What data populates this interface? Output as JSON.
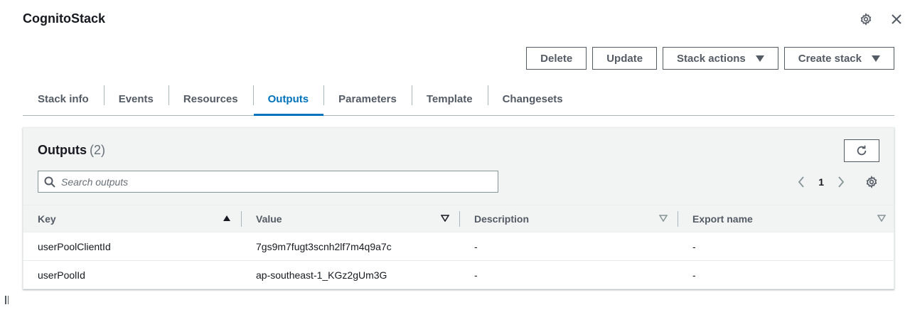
{
  "header": {
    "title": "CognitoStack",
    "settings_icon": "gear-icon",
    "close_icon": "close-icon"
  },
  "actions": {
    "delete": "Delete",
    "update": "Update",
    "stack_actions": "Stack actions",
    "create_stack": "Create stack"
  },
  "tabs": [
    {
      "label": "Stack info",
      "active": false
    },
    {
      "label": "Events",
      "active": false
    },
    {
      "label": "Resources",
      "active": false
    },
    {
      "label": "Outputs",
      "active": true
    },
    {
      "label": "Parameters",
      "active": false
    },
    {
      "label": "Template",
      "active": false
    },
    {
      "label": "Changesets",
      "active": false
    }
  ],
  "outputs": {
    "title": "Outputs",
    "count": "(2)",
    "search_placeholder": "Search outputs",
    "page": "1",
    "columns": [
      "Key",
      "Value",
      "Description",
      "Export name"
    ],
    "rows": [
      {
        "key": "userPoolClientId",
        "value": "7gs9m7fugt3scnh2lf7m4q9a7c",
        "description": "-",
        "export_name": "-"
      },
      {
        "key": "userPoolId",
        "value": "ap-southeast-1_KGz2gUm3G",
        "description": "-",
        "export_name": "-"
      }
    ]
  },
  "colors": {
    "accent": "#0073bb",
    "text": "#16191f",
    "muted": "#545b64",
    "header_bg": "#f2f3f3"
  }
}
